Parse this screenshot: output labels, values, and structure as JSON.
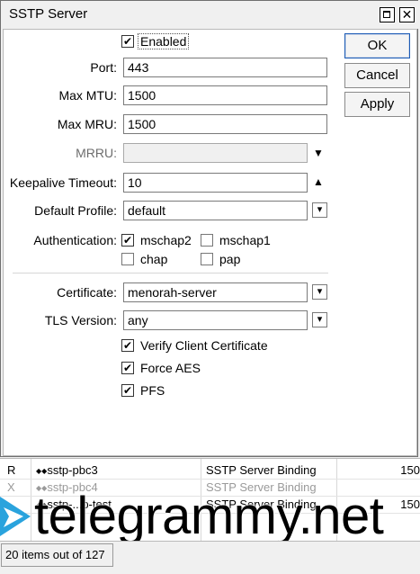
{
  "dialog": {
    "title": "SSTP Server",
    "close_glyph": "✕",
    "enabled": {
      "label": "Enabled",
      "checked": true
    },
    "fields": {
      "port": {
        "label": "Port:",
        "value": "443"
      },
      "max_mtu": {
        "label": "Max MTU:",
        "value": "1500"
      },
      "max_mru": {
        "label": "Max MRU:",
        "value": "1500"
      },
      "mrru": {
        "label": "MRRU:",
        "value": ""
      },
      "keepalive": {
        "label": "Keepalive Timeout:",
        "value": "10"
      },
      "default_profile": {
        "label": "Default Profile:",
        "value": "default"
      },
      "certificate": {
        "label": "Certificate:",
        "value": "menorah-server"
      },
      "tls_version": {
        "label": "TLS Version:",
        "value": "any"
      }
    },
    "authentication": {
      "label": "Authentication:",
      "options": [
        {
          "label": "mschap2",
          "checked": true
        },
        {
          "label": "mschap1",
          "checked": false
        },
        {
          "label": "chap",
          "checked": false
        },
        {
          "label": "pap",
          "checked": false
        }
      ]
    },
    "options": {
      "verify_client_certificate": {
        "label": "Verify Client Certificate",
        "checked": true
      },
      "force_aes": {
        "label": "Force AES",
        "checked": true
      },
      "pfs": {
        "label": "PFS",
        "checked": true
      }
    },
    "buttons": {
      "ok": "OK",
      "cancel": "Cancel",
      "apply": "Apply"
    },
    "check_glyph": "✔"
  },
  "table": {
    "rows": [
      {
        "flag": "R",
        "name": "sstp-pbc3",
        "type": "SSTP Server Binding",
        "mtu": "150"
      },
      {
        "flag": "X",
        "name": "sstp-pbc4",
        "type": "SSTP Server Binding",
        "mtu": ""
      },
      {
        "flag": "",
        "name": "sstp-...p-test",
        "type": "SSTP Server Binding",
        "mtu": "150"
      }
    ],
    "iface_icon": "◆◆"
  },
  "watermark": {
    "text": "telegrammy.net"
  },
  "status": {
    "text": "20 items out of 127"
  }
}
